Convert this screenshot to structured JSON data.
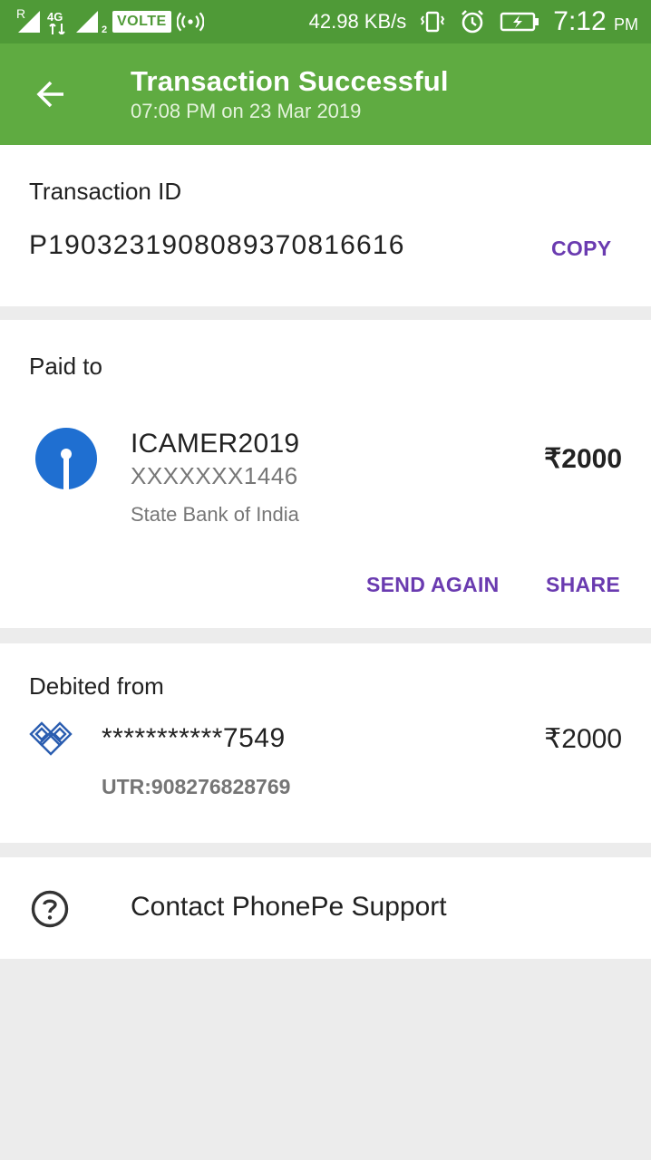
{
  "status_bar": {
    "network_type": "4G",
    "volte_label": "VOLTE",
    "speed": "42.98 KB/s",
    "time": "7:12",
    "time_suffix": "PM",
    "sim_roaming_label": "R",
    "sim2_label": "2"
  },
  "header": {
    "back_icon": "arrow-back-icon",
    "title": "Transaction Successful",
    "subtitle": "07:08 PM on 23 Mar 2019",
    "color": "#5fab41"
  },
  "transaction": {
    "label": "Transaction ID",
    "id": "P1903231908089370816616",
    "copy_label": "COPY"
  },
  "paid_to": {
    "label": "Paid to",
    "payee_name": "ICAMER2019",
    "account": "XXXXXXX1446",
    "bank": "State Bank of India",
    "amount": "₹2000",
    "send_again_label": "SEND AGAIN",
    "share_label": "SHARE",
    "bank_icon": "sbi-logo-icon"
  },
  "debited_from": {
    "label": "Debited from",
    "account": "***********7549",
    "amount": "₹2000",
    "utr": "UTR:908276828769",
    "bank_icon": "bank-of-baroda-logo-icon"
  },
  "support": {
    "label": "Contact PhonePe Support",
    "icon": "help-circle-icon"
  },
  "colors": {
    "accent": "#6a3bb0",
    "status_bar": "#4f9a37",
    "sbi_blue": "#1f6fd1"
  }
}
